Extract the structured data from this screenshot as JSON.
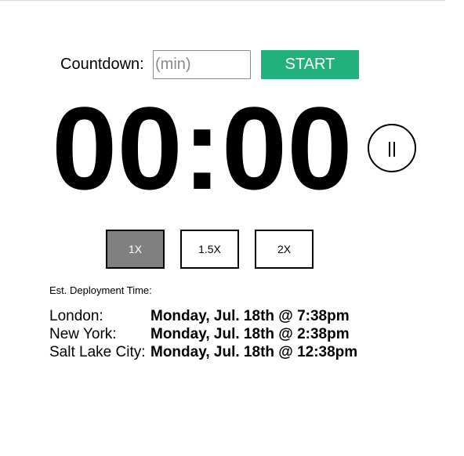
{
  "countdown": {
    "label": "Countdown:",
    "input_value": "",
    "input_placeholder": "(min)",
    "start_label": "START"
  },
  "timer": {
    "display": "00:00",
    "pause_icon": "pause-icon"
  },
  "speeds": {
    "options": [
      "1X",
      "1.5X",
      "2X"
    ],
    "selected": "1X"
  },
  "deployment": {
    "label": "Est. Deployment Time:",
    "zones": [
      {
        "city": "London:",
        "time": "Monday, Jul. 18th @ 7:38pm"
      },
      {
        "city": "New York:",
        "time": "Monday, Jul. 18th @ 2:38pm"
      },
      {
        "city": "Salt Lake City:",
        "time": "Monday, Jul. 18th @ 12:38pm"
      }
    ]
  },
  "colors": {
    "start_button": "#22b07d",
    "active_speed": "#808080"
  }
}
